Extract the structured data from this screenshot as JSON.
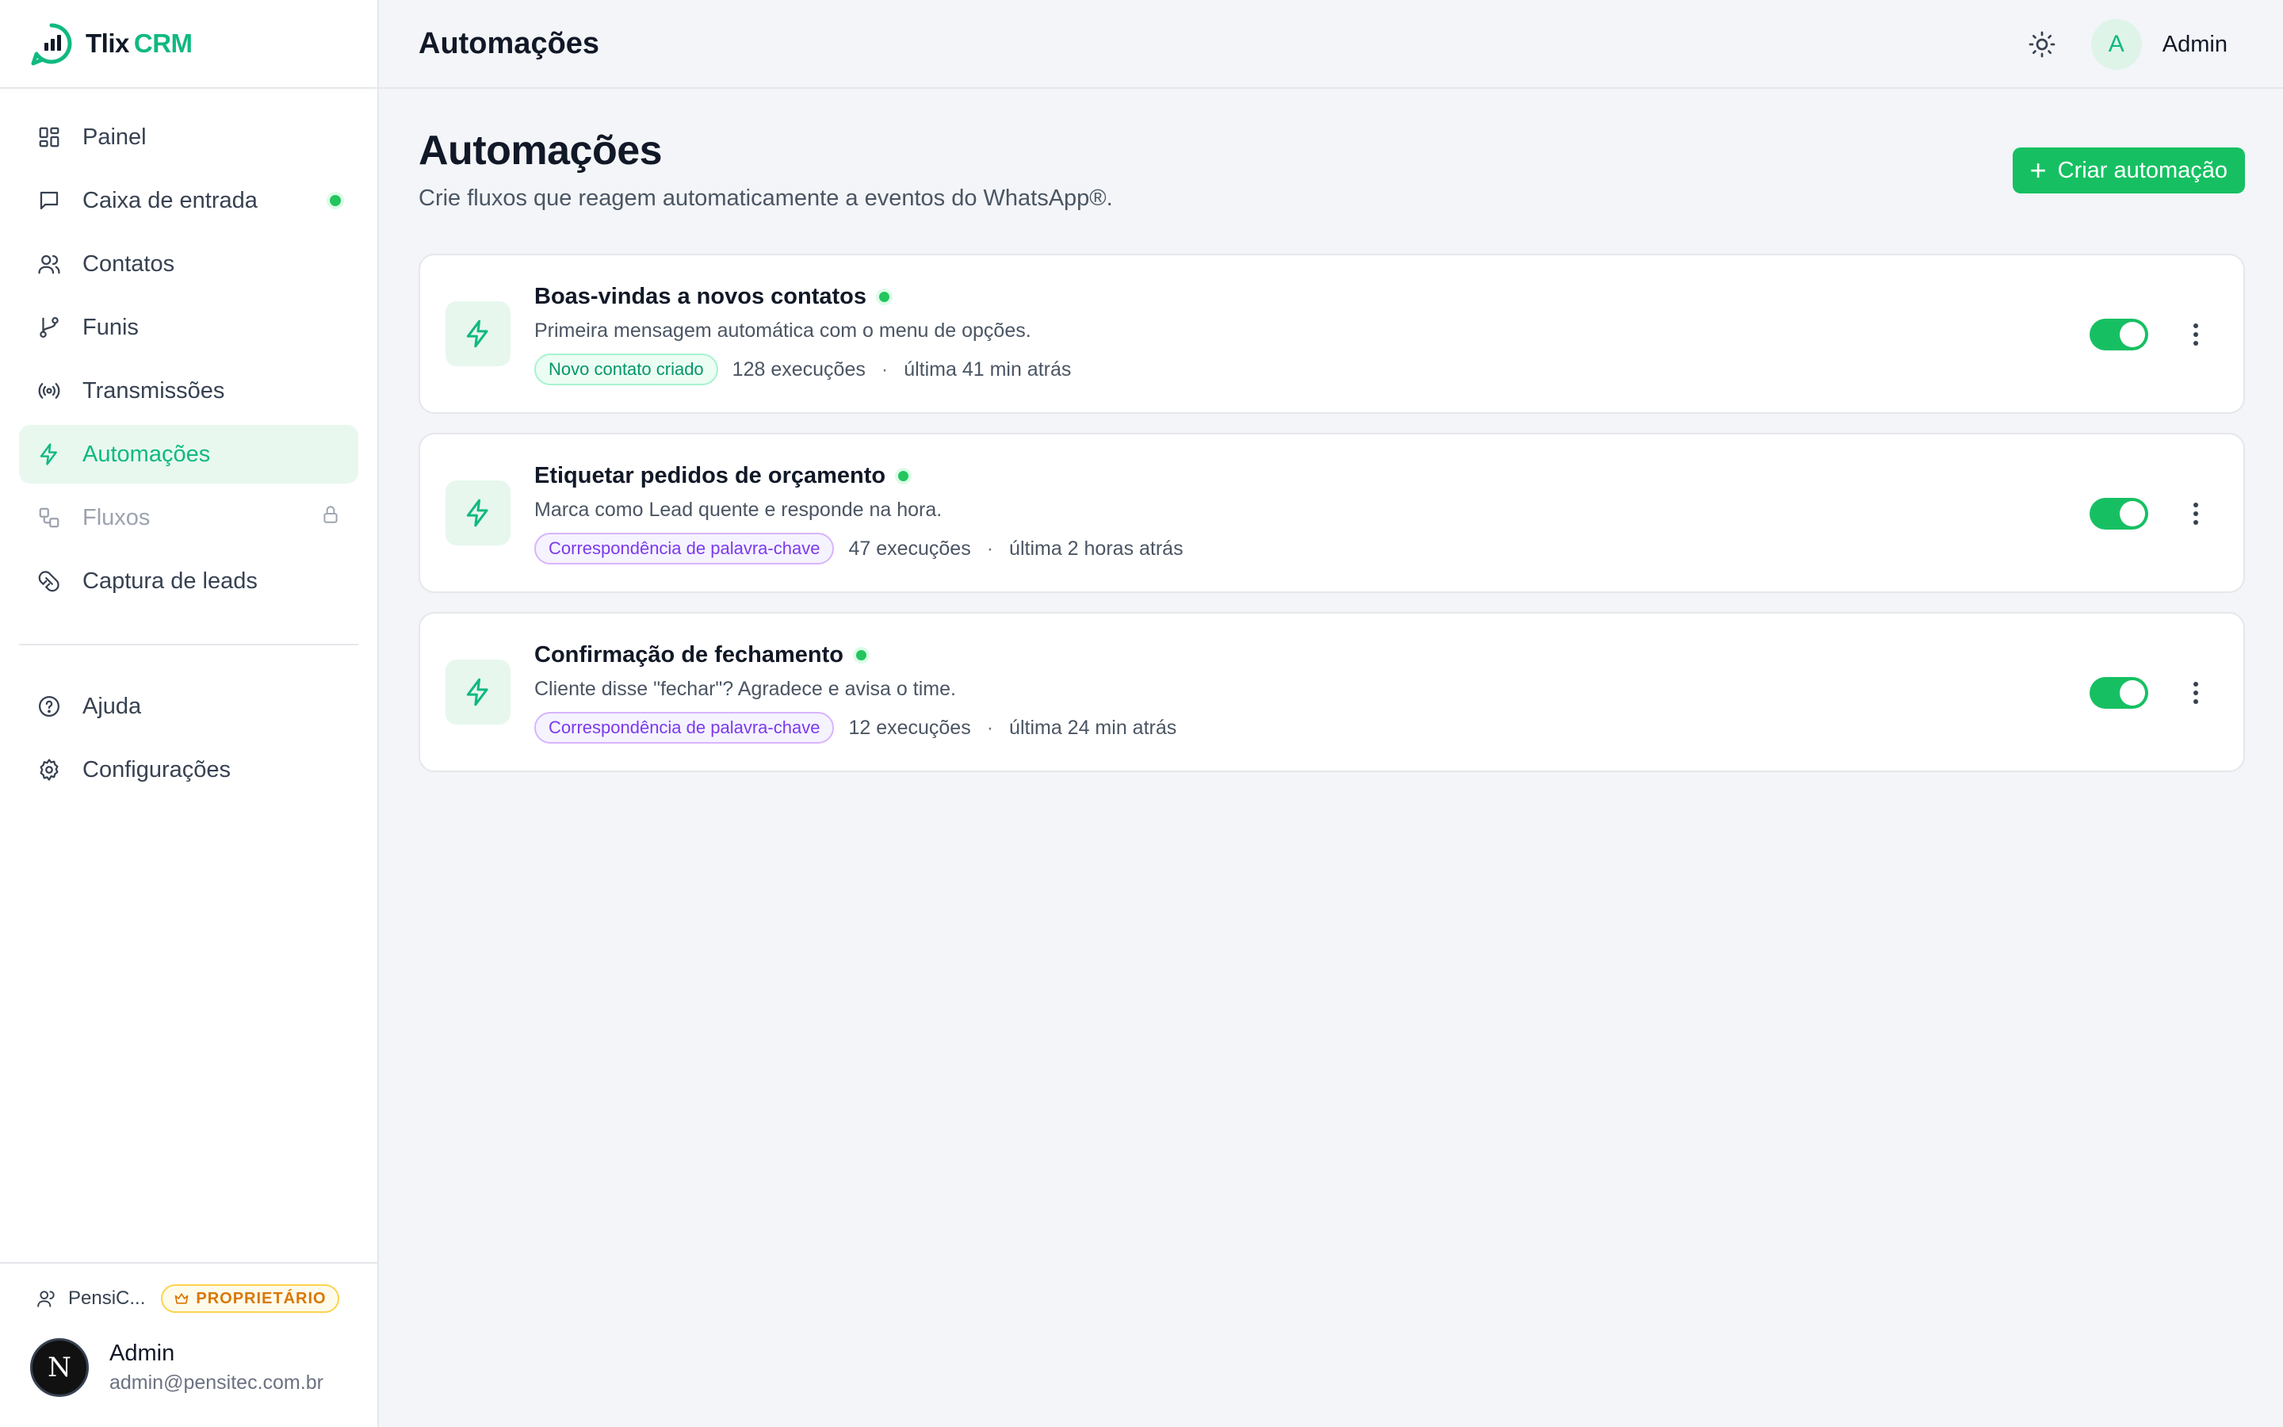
{
  "brand": {
    "name": "Tlix",
    "accent": "CRM"
  },
  "sidebar": {
    "items": [
      {
        "label": "Painel",
        "icon": "dashboard-icon"
      },
      {
        "label": "Caixa de entrada",
        "icon": "chat-icon",
        "indicator": "online-dot"
      },
      {
        "label": "Contatos",
        "icon": "users-icon"
      },
      {
        "label": "Funis",
        "icon": "git-branch-icon"
      },
      {
        "label": "Transmissões",
        "icon": "broadcast-icon"
      },
      {
        "label": "Automações",
        "icon": "zap-icon",
        "active": true
      },
      {
        "label": "Fluxos",
        "icon": "workflow-icon",
        "locked": true
      },
      {
        "label": "Captura de leads",
        "icon": "magnet-icon"
      }
    ],
    "secondary": [
      {
        "label": "Ajuda",
        "icon": "help-icon"
      },
      {
        "label": "Configurações",
        "icon": "settings-icon"
      }
    ],
    "footer": {
      "org_name": "PensiC...",
      "role_badge": "PROPRIETÁRIO",
      "user_initial": "N",
      "user_name": "Admin",
      "user_email": "admin@pensitec.com.br"
    }
  },
  "topbar": {
    "title": "Automações",
    "avatar_initial": "A",
    "user_name": "Admin"
  },
  "page": {
    "title": "Automações",
    "subtitle": "Crie fluxos que reagem automaticamente a eventos do WhatsApp®.",
    "create_label": "Criar automação"
  },
  "automations": [
    {
      "title": "Boas-vindas a novos contatos",
      "description": "Primeira mensagem automática com o menu de opções.",
      "trigger": "Novo contato criado",
      "trigger_style": "green",
      "executions": "128 execuções",
      "last_run": "última 41 min atrás",
      "enabled": true
    },
    {
      "title": "Etiquetar pedidos de orçamento",
      "description": "Marca como Lead quente e responde na hora.",
      "trigger": "Correspondência de palavra-chave",
      "trigger_style": "purple",
      "executions": "47 execuções",
      "last_run": "última 2 horas atrás",
      "enabled": true
    },
    {
      "title": "Confirmação de fechamento",
      "description": "Cliente disse \"fechar\"? Agradece e avisa o time.",
      "trigger": "Correspondência de palavra-chave",
      "trigger_style": "purple",
      "executions": "12 execuções",
      "last_run": "última 24 min atrás",
      "enabled": true
    }
  ],
  "colors": {
    "accent": "#10b981",
    "button": "#16c062",
    "active_bg": "#e8f8ef"
  }
}
